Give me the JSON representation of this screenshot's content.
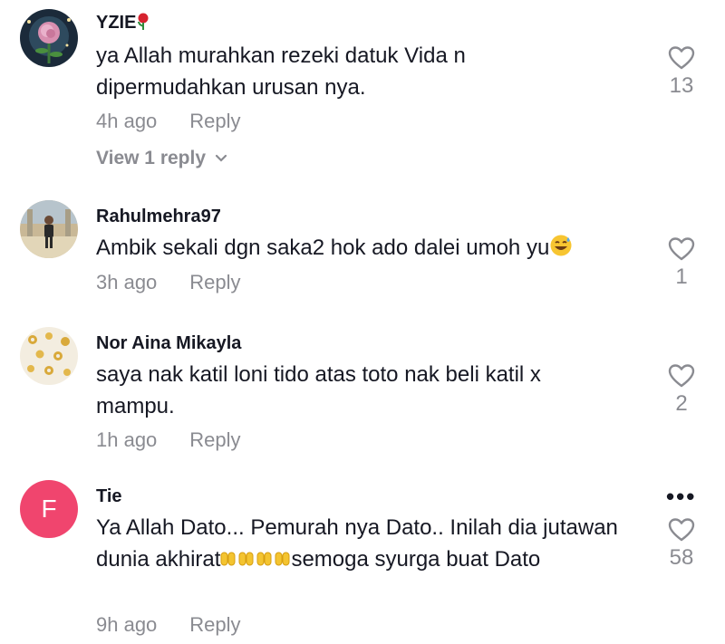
{
  "comments": [
    {
      "username": "YZIE",
      "text": "ya Allah murahkan rezeki datuk Vida n dipermudahkan urusan nya.",
      "time": "4h ago",
      "reply_label": "Reply",
      "likes": "13",
      "view_replies": "View 1 reply"
    },
    {
      "username": "Rahulmehra97",
      "text": "Ambik sekali dgn saka2 hok ado dalei umoh yu",
      "time": "3h ago",
      "reply_label": "Reply",
      "likes": "1"
    },
    {
      "username": "Nor Aina Mikayla",
      "text": "saya nak katil loni tido atas toto nak beli katil x mampu.",
      "time": "1h ago",
      "reply_label": "Reply",
      "likes": "2"
    },
    {
      "username": "Tie",
      "avatar_letter": "F",
      "text_part1": "Ya Allah Dato... Pemurah nya Dato.. Inilah dia jutawan dunia akhirat",
      "text_part2": "semoga syurga buat Dato",
      "time": "9h ago",
      "reply_label": "Reply",
      "likes": "58"
    }
  ],
  "colors": {
    "text": "#161823",
    "secondary": "#8a8b91",
    "avatar_letter_bg": "#f0456e"
  }
}
